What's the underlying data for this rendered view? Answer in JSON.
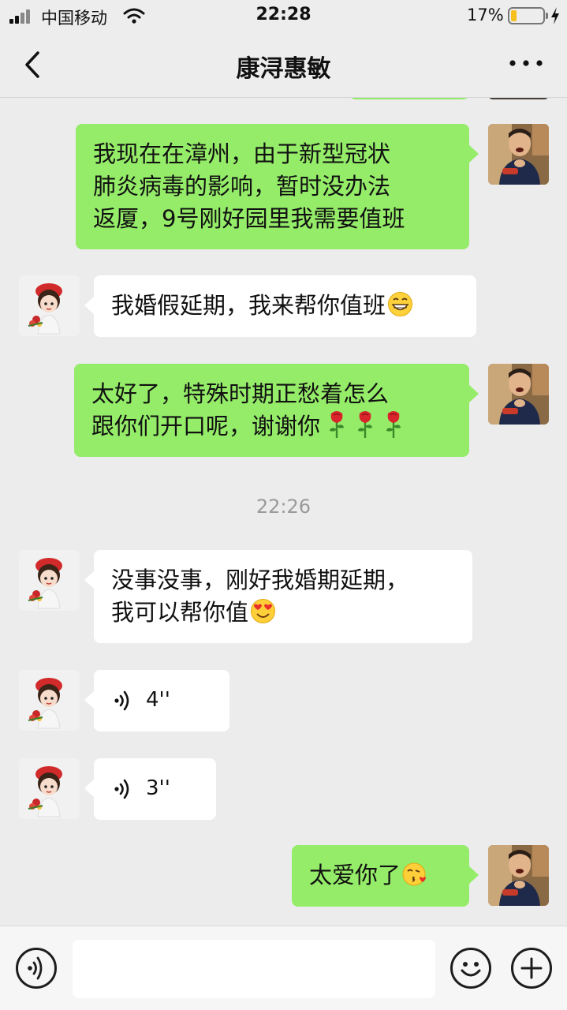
{
  "status_bar": {
    "carrier": "中国移动",
    "time": "22:28",
    "battery_percent": "17%",
    "battery_level": 0.17
  },
  "header": {
    "title": "康浔惠敏"
  },
  "messages": [
    {
      "side": "right",
      "lines": [
        "我现在在漳州，由于新型冠状",
        "肺炎病毒的影响，暂时没办法",
        "返厦，9号刚好园里我需要值班"
      ]
    },
    {
      "side": "left",
      "lines": [
        "我婚假延期，我来帮你值班"
      ],
      "emoji": "grinning-emoji"
    },
    {
      "side": "right",
      "lines": [
        "太好了，特殊时期正愁着怎么",
        "跟你们开口呢，谢谢你"
      ],
      "emoji": "rose-emoji x3"
    },
    {
      "side": "left",
      "lines": [
        "没事没事，刚好我婚期延期，",
        "我可以帮你值"
      ],
      "emoji": "heart-eyes-emoji"
    },
    {
      "side": "left",
      "type": "voice",
      "duration": "4''"
    },
    {
      "side": "left",
      "type": "voice",
      "duration": "3''"
    },
    {
      "side": "right",
      "lines": [
        "太爱你了"
      ],
      "emoji": "kissing-heart-emoji"
    }
  ],
  "timestamp": "22:26",
  "colors": {
    "sent_bubble": "#95ec69",
    "received_bubble": "#ffffff",
    "background": "#ececec",
    "battery": "#f5bf1d"
  },
  "icons": [
    "back-icon",
    "more-icon",
    "voice-input-icon",
    "emoji-icon",
    "plus-icon"
  ]
}
